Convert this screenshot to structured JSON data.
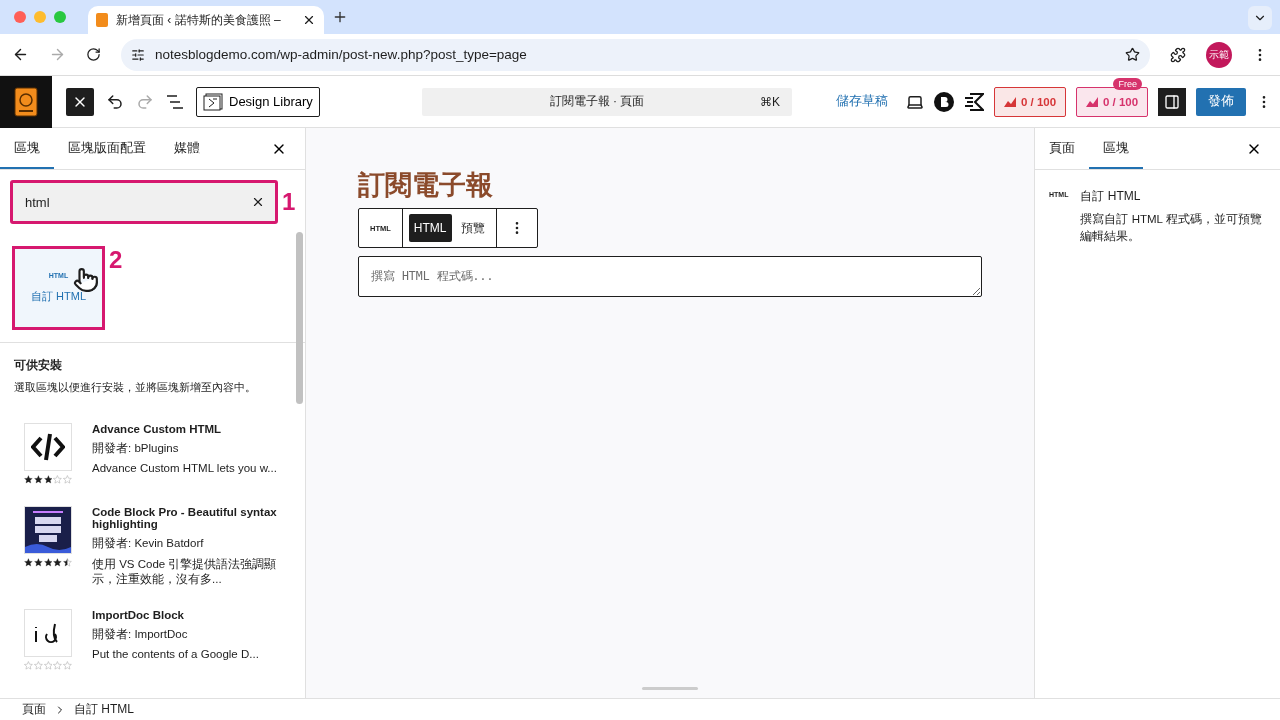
{
  "browser": {
    "tab_title": "新增頁面 ‹ 諾特斯的美食護照 –",
    "url": "notesblogdemo.com/wp-admin/post-new.php?post_type=page",
    "profile": "示範"
  },
  "toolbar": {
    "design_library": "Design Library",
    "command": "訂閱電子報 · 頁面",
    "shortcut": "⌘K",
    "save_draft": "儲存草稿",
    "badges": [
      {
        "text": "0 / 100",
        "color": "#d63638"
      },
      {
        "text": "0 / 100",
        "color": "#d6336c",
        "tag": "Free"
      }
    ],
    "publish": "發佈"
  },
  "inserter": {
    "tabs": [
      {
        "label": "區塊",
        "selected": true
      },
      {
        "label": "區塊版面配置",
        "selected": false
      },
      {
        "label": "媒體",
        "selected": false
      }
    ],
    "search": {
      "value": "html",
      "annotation": "1"
    },
    "results": [
      {
        "icon": "HTML",
        "label": "自訂 HTML",
        "annotation": "2"
      }
    ],
    "install": {
      "title": "可供安裝",
      "hint": "選取區塊以便進行安裝，並將區塊新增至內容中。"
    },
    "plugins": [
      {
        "kind": "code",
        "name": "Advance Custom HTML",
        "author": "開發者: bPlugins",
        "description": "Advance Custom HTML lets you w...",
        "stars": 3
      },
      {
        "kind": "poster",
        "name": "Code Block Pro - Beautiful syntax highlighting",
        "author": "開發者: Kevin Batdorf",
        "description": "使用 VS Code 引擎提供語法強調顯示，注重效能，沒有多...",
        "stars": 4.5
      },
      {
        "kind": "script",
        "name": "ImportDoc Block",
        "author": "開發者: ImportDoc",
        "description": "Put the contents of a Google D...",
        "stars": 0
      }
    ]
  },
  "editor": {
    "heading": "訂閱電子報",
    "block_icon": "HTML",
    "modes": [
      {
        "label": "HTML",
        "selected": true
      },
      {
        "label": "預覽",
        "selected": false
      }
    ],
    "placeholder": "撰寫 HTML 程式碼..."
  },
  "settings": {
    "tabs": [
      {
        "label": "頁面",
        "selected": false
      },
      {
        "label": "區塊",
        "selected": true
      }
    ],
    "block": {
      "icon": "HTML",
      "name": "自訂 HTML",
      "description": "撰寫自訂 HTML 程式碼，並可預覽編輯結果。"
    }
  },
  "breadcrumb": [
    "頁面",
    "自訂 HTML"
  ]
}
